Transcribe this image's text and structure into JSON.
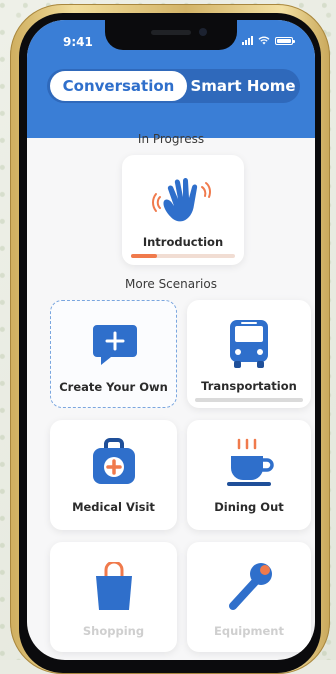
{
  "status_bar": {
    "time": "9:41"
  },
  "tabs": [
    {
      "label": "Conversation",
      "active": true
    },
    {
      "label": "Smart Home",
      "active": false
    }
  ],
  "in_progress": {
    "heading": "In Progress",
    "card": {
      "label": "Introduction",
      "icon": "waving-hand-icon",
      "progress_percent": 25
    }
  },
  "more_scenarios": {
    "heading": "More Scenarios",
    "cards": [
      {
        "label": "Create Your Own",
        "icon": "speech-bubble-plus-icon"
      },
      {
        "label": "Transportation",
        "icon": "bus-icon"
      },
      {
        "label": "Medical Visit",
        "icon": "medical-bag-icon"
      },
      {
        "label": "Dining Out",
        "icon": "coffee-cup-icon"
      },
      {
        "label": "Shopping",
        "icon": "shopping-bag-icon"
      },
      {
        "label": "Equipment",
        "icon": "wrench-icon"
      }
    ]
  },
  "colors": {
    "header_blue": "#3a7ed6",
    "accent_orange": "#f07a4c",
    "icon_blue": "#2f6fcb"
  }
}
